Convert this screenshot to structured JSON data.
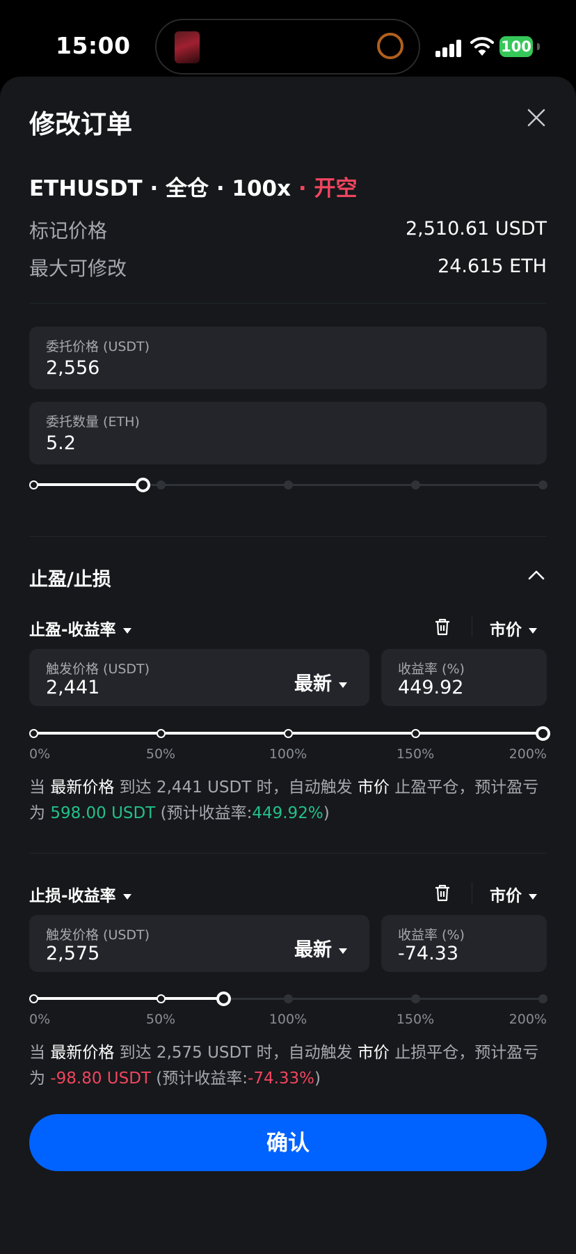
{
  "status": {
    "time": "15:00",
    "battery": "100"
  },
  "sheet": {
    "title": "修改订单",
    "pair": "ETHUSDT",
    "margin_mode": "全仓",
    "leverage": "100x",
    "side": "开空",
    "sep": " · ",
    "rows": [
      {
        "label": "标记价格",
        "value": "2,510.61 USDT"
      },
      {
        "label": "最大可修改",
        "value": "24.615 ETH"
      }
    ],
    "order_price": {
      "label": "委托价格 (USDT)",
      "value": "2,556"
    },
    "order_qty": {
      "label": "委托数量 (ETH)",
      "value": "5.2",
      "slider_percent": 21.4
    }
  },
  "tpsl": {
    "title": "止盈/止损",
    "tp": {
      "mode_label": "止盈-收益率",
      "order_type": "市价",
      "trigger_label": "触发价格 (USDT)",
      "trigger_value": "2,441",
      "price_source": "最新",
      "rate_label": "收益率 (%)",
      "rate_value": "449.92",
      "slider_percent": 100,
      "ticks": [
        "0%",
        "50%",
        "100%",
        "150%",
        "200%"
      ],
      "desc": {
        "p1": "当 ",
        "src": "最新价格",
        "p2": " 到达 2,441 USDT 时，自动触发 ",
        "type": "市价",
        "p3": " 止盈平仓，预计盈亏为 ",
        "pnl": "598.00 USDT",
        "p4": " (预计收益率:",
        "pct": "449.92%",
        "p5": ")"
      }
    },
    "sl": {
      "mode_label": "止损-收益率",
      "order_type": "市价",
      "trigger_label": "触发价格 (USDT)",
      "trigger_value": "2,575",
      "price_source": "最新",
      "rate_label": "收益率 (%)",
      "rate_value": "-74.33",
      "slider_percent": 37.3,
      "ticks": [
        "0%",
        "50%",
        "100%",
        "150%",
        "200%"
      ],
      "desc": {
        "p1": "当 ",
        "src": "最新价格",
        "p2": " 到达 2,575 USDT 时，自动触发 ",
        "type": "市价",
        "p3": " 止损平仓，预计盈亏为 ",
        "pnl": "-98.80 USDT",
        "p4": " (预计收益率:",
        "pct": "-74.33%",
        "p5": ")"
      }
    }
  },
  "confirm_label": "确认",
  "colors": {
    "accent": "#0062ff",
    "short": "#f0455f",
    "profit": "#23c08a",
    "sheet_bg": "#16181b",
    "field_bg": "#23252a"
  }
}
